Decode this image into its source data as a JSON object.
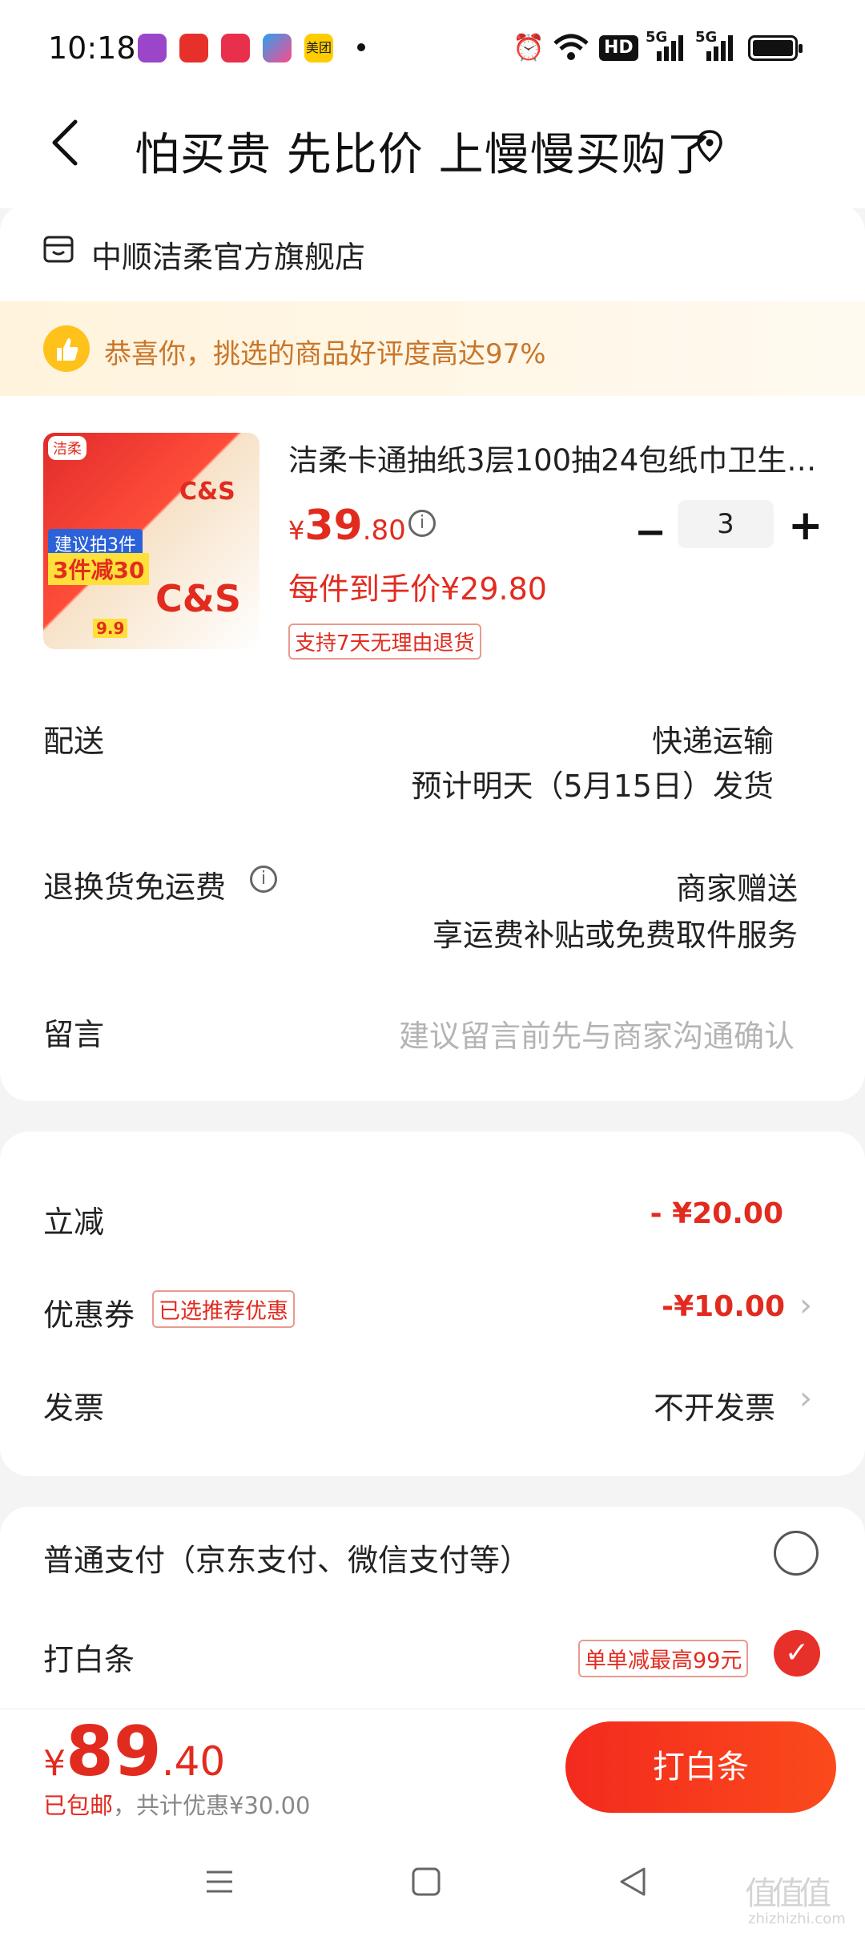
{
  "status_bar": {
    "time": "10:18",
    "app_icons": [
      {
        "name": "app-1-icon",
        "color": "#9b46c8"
      },
      {
        "name": "jd-icon",
        "color": "#e8302a"
      },
      {
        "name": "app-3-icon",
        "color": "#e8304d"
      },
      {
        "name": "app-4-icon",
        "color": "#2aa1f0"
      },
      {
        "name": "meituan-icon",
        "color": "#ffcc00",
        "label": "美团"
      }
    ],
    "hd_label": "HD",
    "signal_label": "5G"
  },
  "header": {
    "title": "怕买贵 先比价 上慢慢买购了"
  },
  "store": {
    "name": "中顺洁柔官方旗舰店"
  },
  "banner": {
    "text": "恭喜你，挑选的商品好评度高达97%"
  },
  "product": {
    "title": "洁柔卡通抽纸3层100抽24包纸巾卫生…",
    "price_symbol": "¥",
    "price_int": "39",
    "price_dec": ".80",
    "per_price": "每件到手价¥29.80",
    "return_tag": "支持7天无理由退货",
    "quantity": "3",
    "image_texts": {
      "badge": "洁柔",
      "promo": "建议拍3件",
      "deal": "3件减30",
      "brand": "C&S",
      "low": "9.9"
    }
  },
  "delivery": {
    "label": "配送",
    "method": "快递运输",
    "eta": "预计明天（5月15日）发货"
  },
  "return_shipping": {
    "label": "退换货免运费",
    "value": "商家赠送",
    "desc": "享运费补贴或免费取件服务"
  },
  "message": {
    "label": "留言",
    "placeholder": "建议留言前先与商家沟通确认"
  },
  "discounts": {
    "instant_label": "立减",
    "instant_value": "- ¥20.00",
    "coupon_label": "优惠券",
    "coupon_badge": "已选推荐优惠",
    "coupon_value": "-¥10.00",
    "invoice_label": "发票",
    "invoice_value": "不开发票"
  },
  "payment": {
    "normal_label": "普通支付（京东支付、微信支付等）",
    "baitiao_label": "打白条",
    "baitiao_badge": "单单减最高99元"
  },
  "bottom": {
    "price_symbol": "¥",
    "total_int": "89",
    "total_dec": ".40",
    "shipping": "已包邮",
    "saving": "，共计优惠¥30.00",
    "button": "打白条"
  },
  "watermark": {
    "text": "值值值",
    "site": "zhizhizhi.com"
  }
}
